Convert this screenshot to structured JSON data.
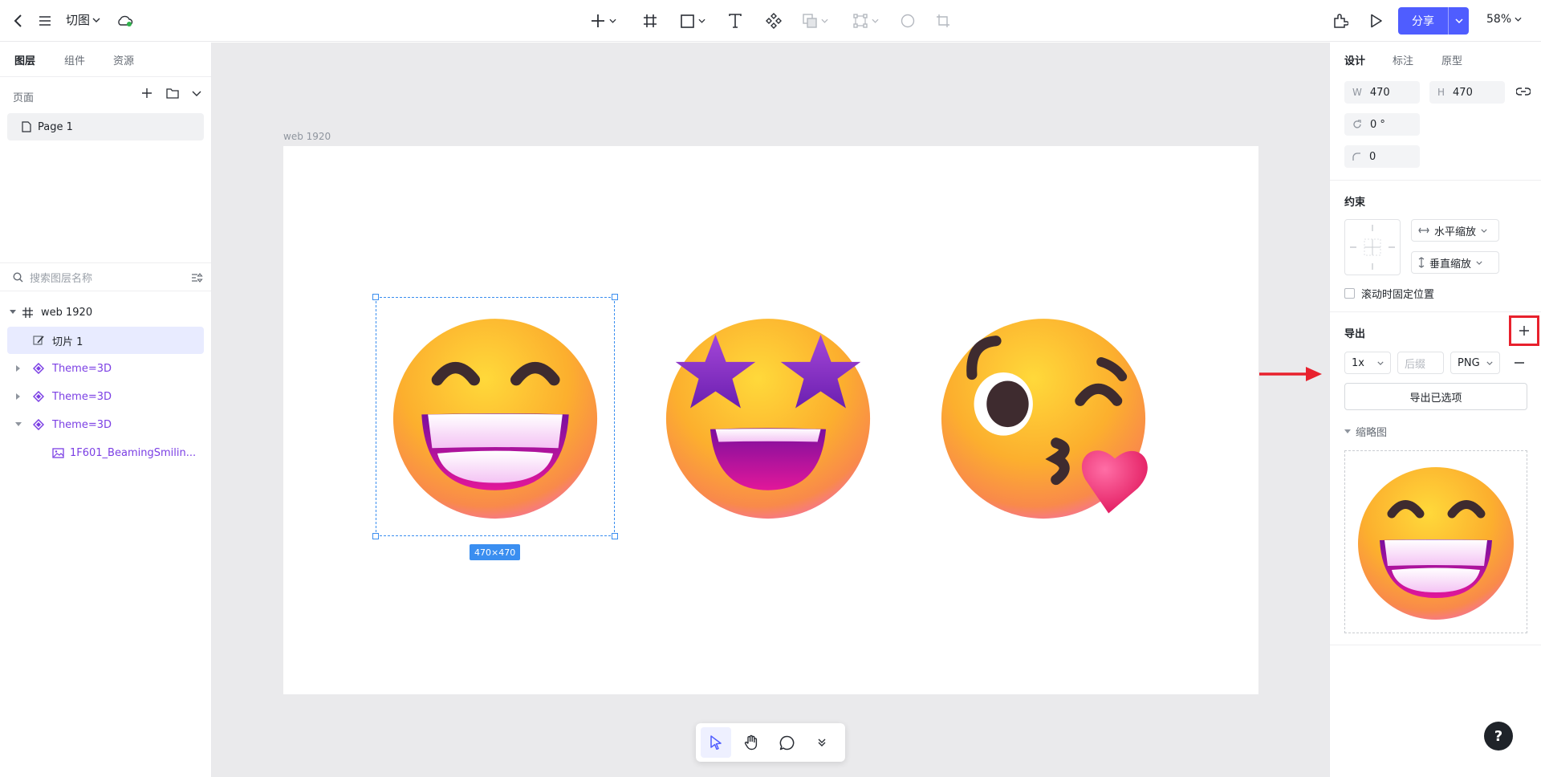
{
  "topbar": {
    "file_name": "切图",
    "share_label": "分享",
    "zoom": "58%"
  },
  "left": {
    "tabs": [
      "图层",
      "组件",
      "资源"
    ],
    "pages_title": "页面",
    "page_item": "Page 1",
    "search_placeholder": "搜索图层名称",
    "layers": [
      {
        "label": "web 1920",
        "type": "frame"
      },
      {
        "label": "切片 1",
        "type": "slice"
      },
      {
        "label": "Theme=3D",
        "type": "component"
      },
      {
        "label": "Theme=3D",
        "type": "component"
      },
      {
        "label": "Theme=3D",
        "type": "component"
      },
      {
        "label": "1F601_BeamingSmilin...",
        "type": "image"
      }
    ]
  },
  "canvas": {
    "frame_label": "web 1920",
    "size_badge": "470×470"
  },
  "right": {
    "tabs": [
      "设计",
      "标注",
      "原型"
    ],
    "w_prefix": "W",
    "w_value": "470",
    "h_prefix": "H",
    "h_value": "470",
    "rotation": "0 °",
    "radius": "0",
    "constraints_title": "约束",
    "h_constraint": "水平缩放",
    "v_constraint": "垂直缩放",
    "fix_on_scroll": "滚动时固定位置",
    "export_title": "导出",
    "export_scale": "1x",
    "export_suffix_placeholder": "后缀",
    "export_format": "PNG",
    "export_button": "导出已选项",
    "thumbnail_title": "缩略图"
  },
  "help": "?",
  "colors": {
    "accent": "#4f5dff",
    "selection": "#3a8ef0",
    "highlight_red": "#e8212d",
    "component_purple": "#7b3fe4"
  }
}
